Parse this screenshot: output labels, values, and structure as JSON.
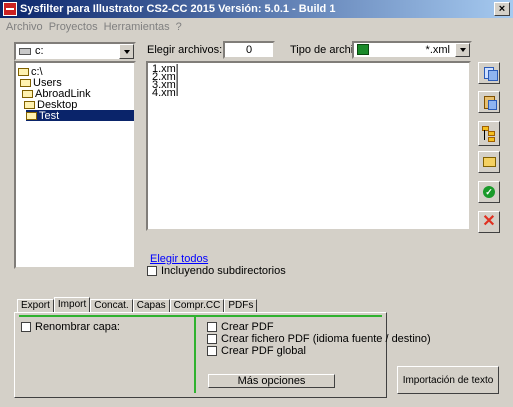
{
  "window": {
    "title": "Sysfilter para Illustrator CS2-CC 2015  Versión: 5.0.1 - Build 1",
    "close_symbol": "×"
  },
  "menu": [
    "Archivo",
    "Proyectos",
    "Herramientas",
    "?"
  ],
  "drive": {
    "value": "c:",
    "icon": "drive-icon"
  },
  "tree": [
    {
      "label": "c:\\",
      "level": 0,
      "selected": false
    },
    {
      "label": "Users",
      "level": 1,
      "selected": false
    },
    {
      "label": "AbroadLink",
      "level": 2,
      "selected": false
    },
    {
      "label": "Desktop",
      "level": 3,
      "selected": false
    },
    {
      "label": "Test",
      "level": 4,
      "selected": true
    }
  ],
  "elegir": {
    "label": "Elegir archivos:",
    "count": "0"
  },
  "tipo": {
    "label": "Tipo de archivo:",
    "value": "*.xml"
  },
  "files": [
    "1.xml",
    "2.xml",
    "3.xml",
    "4.xml"
  ],
  "elegir_todos": "Elegir todos",
  "incluyendo": "Incluyendo subdirectorios",
  "tabs": [
    "Export",
    "Import",
    "Concat.",
    "Capas",
    "Compr.CC",
    "PDFs"
  ],
  "active_tab": "Import",
  "panel": {
    "renombrar": "Renombrar capa:",
    "crear_pdf": "Crear PDF",
    "crear_fichero": "Crear fichero PDF (idioma fuente / destino)",
    "crear_global": "Crear PDF global",
    "mas_opciones": "Más opciones"
  },
  "import_button": "Importación de texto",
  "side_icons": [
    "copy-icon",
    "paste-icon",
    "tree-icon",
    "open-folder-icon",
    "ok-icon",
    "delete-icon"
  ],
  "colors": {
    "title_start": "#0a246a",
    "title_end": "#a6caf0",
    "selection": "#0a246a",
    "accent_line": "#2fb22f",
    "link": "#0000ff"
  }
}
